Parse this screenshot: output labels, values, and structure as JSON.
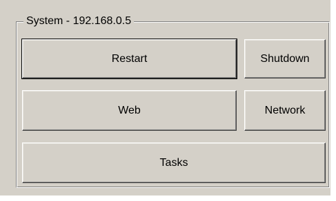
{
  "group": {
    "title": "System - 192.168.0.5"
  },
  "buttons": {
    "restart": "Restart",
    "shutdown": "Shutdown",
    "web": "Web",
    "network": "Network",
    "tasks": "Tasks"
  },
  "colors": {
    "face": "#d4d0c8",
    "shadow": "#808080",
    "highlight": "#ffffff"
  }
}
